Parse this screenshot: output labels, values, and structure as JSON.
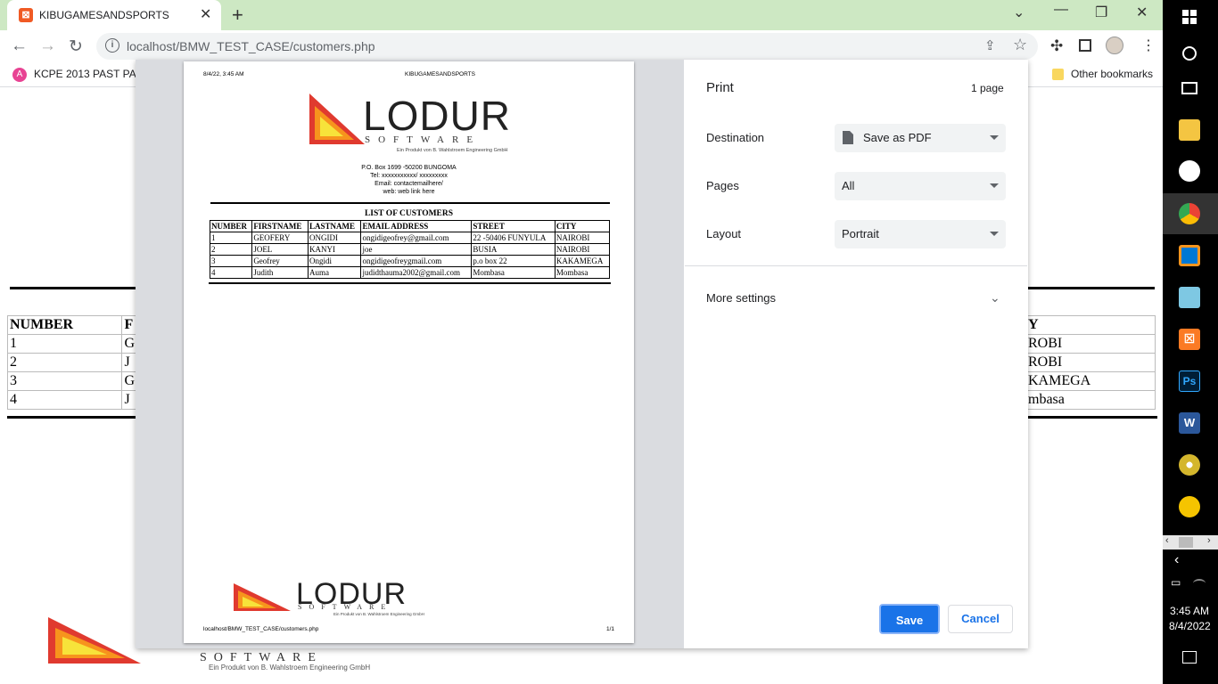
{
  "browser": {
    "tab_title": "KIBUGAMESANDSPORTS",
    "new_tab": "+",
    "url": "localhost/BMW_TEST_CASE/customers.php",
    "bookmarks": [
      "KCPE 2013 PAST PA...",
      "Other bookmarks"
    ]
  },
  "background_table": {
    "header": "NUMBER",
    "col2_initial": "F",
    "rows": [
      "1",
      "2",
      "3",
      "4"
    ],
    "col2": [
      "G",
      "J",
      "G",
      "J"
    ],
    "right_header": "Y",
    "right_col": [
      "ROBI",
      "ROBI",
      "KAMEGA",
      "mbasa"
    ]
  },
  "preview": {
    "date": "8/4/22, 3:45 AM",
    "site": "KIBUGAMESANDSPORTS",
    "logo_word": "LODUR",
    "logo_sub": "SOFTWARE",
    "logo_tag": "Ein Produkt von B. Wahlstroem Engineering GmbH",
    "address": [
      "P.O. Box 1699 -50200 BUNGOMA",
      "Tel: xxxxxxxxxxx/ xxxxxxxxx",
      "Email: contactemailhere/",
      "web: web link here"
    ],
    "table_title": "LIST OF CUSTOMERS",
    "columns": [
      "NUMBER",
      "FIRSTNAME",
      "LASTNAME",
      "EMAIL ADDRESS",
      "STREET",
      "CITY"
    ],
    "rows": [
      [
        "1",
        "GEOFERY",
        "ONGIDI",
        "ongidigeofrey@gmail.com",
        "22 -50406 FUNYULA",
        "NAIROBI"
      ],
      [
        "2",
        "JOEL",
        "KANYI",
        "joe",
        "BUSIA",
        "NAIROBI"
      ],
      [
        "3",
        "Geofrey",
        "Ongidi",
        "ongidigeofreygmail.com",
        "p.o box 22",
        "KAKAMEGA"
      ],
      [
        "4",
        "Judith",
        "Auma",
        "judidthauma2002@gmail.com",
        "Mombasa",
        "Mombasa"
      ]
    ],
    "footer_url": "localhost/BMW_TEST_CASE/customers.php",
    "footer_page": "1/1"
  },
  "print": {
    "title": "Print",
    "page_count": "1 page",
    "destination_label": "Destination",
    "destination_value": "Save as PDF",
    "pages_label": "Pages",
    "pages_value": "All",
    "layout_label": "Layout",
    "layout_value": "Portrait",
    "more_settings": "More settings",
    "save": "Save",
    "cancel": "Cancel"
  },
  "taskbar": {
    "time": "3:45 AM",
    "date": "8/4/2022",
    "ps_label": "Ps",
    "word_label": "W"
  }
}
